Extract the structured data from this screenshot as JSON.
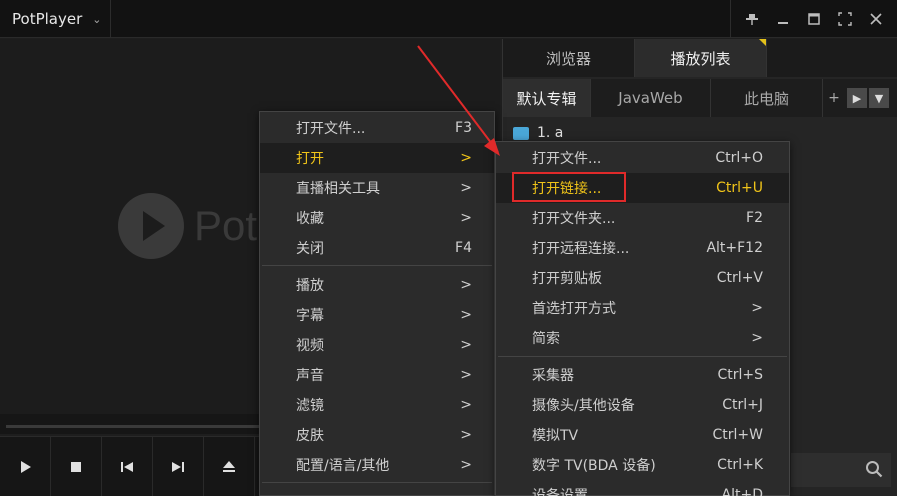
{
  "app": {
    "title": "PotPlayer",
    "logo_text": "Pot"
  },
  "window_icons": [
    "pin-icon",
    "minimize-icon",
    "maximize-icon",
    "fullscreen-icon",
    "close-icon"
  ],
  "panel": {
    "tabs": [
      {
        "label": "浏览器"
      },
      {
        "label": "播放列表"
      }
    ],
    "subtabs": [
      {
        "label": "默认专辑"
      },
      {
        "label": "JavaWeb"
      },
      {
        "label": "此电脑"
      }
    ],
    "plus": "+",
    "item": "1. a"
  },
  "menu1": [
    {
      "label": "打开文件...",
      "shortcut": "F3"
    },
    {
      "label": "打开",
      "shortcut": ">"
    },
    {
      "label": "直播相关工具",
      "shortcut": ">"
    },
    {
      "label": "收藏",
      "shortcut": ">"
    },
    {
      "label": "关闭",
      "shortcut": "F4"
    },
    {
      "label": "播放",
      "shortcut": ">"
    },
    {
      "label": "字幕",
      "shortcut": ">"
    },
    {
      "label": "视频",
      "shortcut": ">"
    },
    {
      "label": "声音",
      "shortcut": ">"
    },
    {
      "label": "滤镜",
      "shortcut": ">"
    },
    {
      "label": "皮肤",
      "shortcut": ">"
    },
    {
      "label": "配置/语言/其他",
      "shortcut": ">"
    },
    {
      "label": "...",
      "shortcut": ""
    }
  ],
  "menu2": [
    {
      "label": "打开文件...",
      "shortcut": "Ctrl+O"
    },
    {
      "label": "打开链接...",
      "shortcut": "Ctrl+U"
    },
    {
      "label": "打开文件夹...",
      "shortcut": "F2"
    },
    {
      "label": "打开远程连接...",
      "shortcut": "Alt+F12"
    },
    {
      "label": "打开剪贴板",
      "shortcut": "Ctrl+V"
    },
    {
      "label": "首选打开方式",
      "shortcut": ">"
    },
    {
      "label": "简索",
      "shortcut": ">"
    },
    {
      "label": "采集器",
      "shortcut": "Ctrl+S"
    },
    {
      "label": "摄像头/其他设备",
      "shortcut": "Ctrl+J"
    },
    {
      "label": "模拟TV",
      "shortcut": "Ctrl+W"
    },
    {
      "label": "数字 TV(BDA 设备)",
      "shortcut": "Ctrl+K"
    },
    {
      "label": "设备设置",
      "shortcut": "Alt+D"
    }
  ],
  "colors": {
    "highlight": "#f0c419",
    "accent_box": "#e02a2a"
  }
}
